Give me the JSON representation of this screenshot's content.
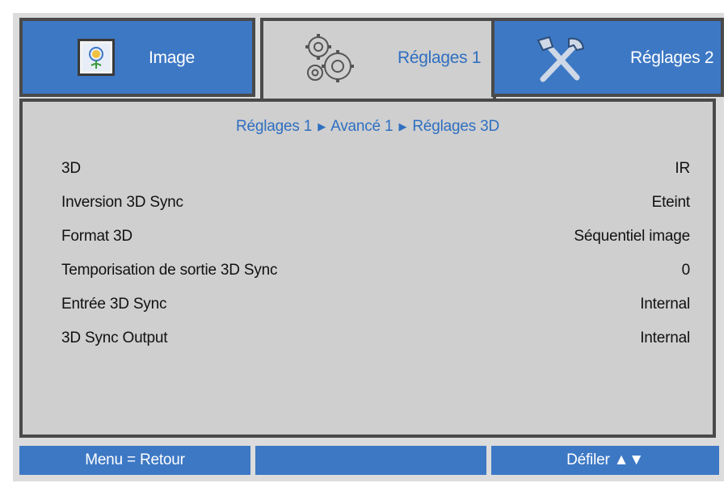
{
  "tabs": [
    {
      "label": "Image",
      "icon": "picture-icon",
      "active": false
    },
    {
      "label": "Réglages 1",
      "icon": "gears-icon",
      "active": true
    },
    {
      "label": "Réglages 2",
      "icon": "tools-icon",
      "active": false
    }
  ],
  "breadcrumb": {
    "parts": [
      "Réglages 1",
      "Avancé 1",
      "Réglages 3D"
    ],
    "separator": "▶"
  },
  "settings": [
    {
      "label": "3D",
      "value": "IR"
    },
    {
      "label": "Inversion 3D Sync",
      "value": "Eteint"
    },
    {
      "label": "Format 3D",
      "value": "Séquentiel image"
    },
    {
      "label": "Temporisation de sortie 3D Sync",
      "value": "0"
    },
    {
      "label": "Entrée 3D Sync",
      "value": "Internal"
    },
    {
      "label": "3D Sync Output",
      "value": "Internal"
    }
  ],
  "footer": {
    "left": "Menu = Retour",
    "middle": "",
    "right": "Défiler ▲▼"
  },
  "colors": {
    "accent_blue": "#3d78c4",
    "active_text": "#2f6fc1",
    "panel_gray": "#cfcfcf",
    "border_dark": "#4a4a4a"
  }
}
